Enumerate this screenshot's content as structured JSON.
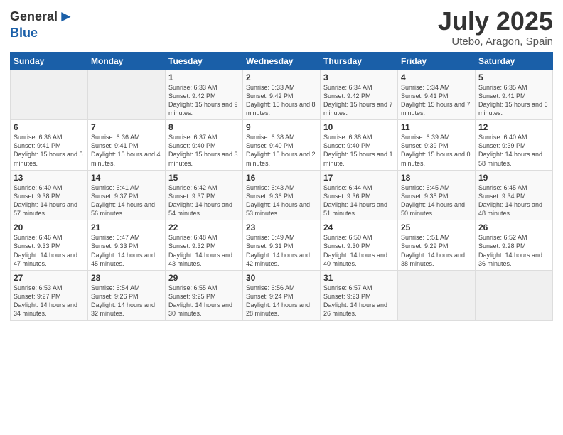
{
  "header": {
    "logo_general": "General",
    "logo_blue": "Blue",
    "month_year": "July 2025",
    "location": "Utebo, Aragon, Spain"
  },
  "weekdays": [
    "Sunday",
    "Monday",
    "Tuesday",
    "Wednesday",
    "Thursday",
    "Friday",
    "Saturday"
  ],
  "weeks": [
    [
      {
        "day": "",
        "info": ""
      },
      {
        "day": "",
        "info": ""
      },
      {
        "day": "1",
        "info": "Sunrise: 6:33 AM\nSunset: 9:42 PM\nDaylight: 15 hours\nand 9 minutes."
      },
      {
        "day": "2",
        "info": "Sunrise: 6:33 AM\nSunset: 9:42 PM\nDaylight: 15 hours\nand 8 minutes."
      },
      {
        "day": "3",
        "info": "Sunrise: 6:34 AM\nSunset: 9:42 PM\nDaylight: 15 hours\nand 7 minutes."
      },
      {
        "day": "4",
        "info": "Sunrise: 6:34 AM\nSunset: 9:41 PM\nDaylight: 15 hours\nand 7 minutes."
      },
      {
        "day": "5",
        "info": "Sunrise: 6:35 AM\nSunset: 9:41 PM\nDaylight: 15 hours\nand 6 minutes."
      }
    ],
    [
      {
        "day": "6",
        "info": "Sunrise: 6:36 AM\nSunset: 9:41 PM\nDaylight: 15 hours\nand 5 minutes."
      },
      {
        "day": "7",
        "info": "Sunrise: 6:36 AM\nSunset: 9:41 PM\nDaylight: 15 hours\nand 4 minutes."
      },
      {
        "day": "8",
        "info": "Sunrise: 6:37 AM\nSunset: 9:40 PM\nDaylight: 15 hours\nand 3 minutes."
      },
      {
        "day": "9",
        "info": "Sunrise: 6:38 AM\nSunset: 9:40 PM\nDaylight: 15 hours\nand 2 minutes."
      },
      {
        "day": "10",
        "info": "Sunrise: 6:38 AM\nSunset: 9:40 PM\nDaylight: 15 hours\nand 1 minute."
      },
      {
        "day": "11",
        "info": "Sunrise: 6:39 AM\nSunset: 9:39 PM\nDaylight: 15 hours\nand 0 minutes."
      },
      {
        "day": "12",
        "info": "Sunrise: 6:40 AM\nSunset: 9:39 PM\nDaylight: 14 hours\nand 58 minutes."
      }
    ],
    [
      {
        "day": "13",
        "info": "Sunrise: 6:40 AM\nSunset: 9:38 PM\nDaylight: 14 hours\nand 57 minutes."
      },
      {
        "day": "14",
        "info": "Sunrise: 6:41 AM\nSunset: 9:37 PM\nDaylight: 14 hours\nand 56 minutes."
      },
      {
        "day": "15",
        "info": "Sunrise: 6:42 AM\nSunset: 9:37 PM\nDaylight: 14 hours\nand 54 minutes."
      },
      {
        "day": "16",
        "info": "Sunrise: 6:43 AM\nSunset: 9:36 PM\nDaylight: 14 hours\nand 53 minutes."
      },
      {
        "day": "17",
        "info": "Sunrise: 6:44 AM\nSunset: 9:36 PM\nDaylight: 14 hours\nand 51 minutes."
      },
      {
        "day": "18",
        "info": "Sunrise: 6:45 AM\nSunset: 9:35 PM\nDaylight: 14 hours\nand 50 minutes."
      },
      {
        "day": "19",
        "info": "Sunrise: 6:45 AM\nSunset: 9:34 PM\nDaylight: 14 hours\nand 48 minutes."
      }
    ],
    [
      {
        "day": "20",
        "info": "Sunrise: 6:46 AM\nSunset: 9:33 PM\nDaylight: 14 hours\nand 47 minutes."
      },
      {
        "day": "21",
        "info": "Sunrise: 6:47 AM\nSunset: 9:33 PM\nDaylight: 14 hours\nand 45 minutes."
      },
      {
        "day": "22",
        "info": "Sunrise: 6:48 AM\nSunset: 9:32 PM\nDaylight: 14 hours\nand 43 minutes."
      },
      {
        "day": "23",
        "info": "Sunrise: 6:49 AM\nSunset: 9:31 PM\nDaylight: 14 hours\nand 42 minutes."
      },
      {
        "day": "24",
        "info": "Sunrise: 6:50 AM\nSunset: 9:30 PM\nDaylight: 14 hours\nand 40 minutes."
      },
      {
        "day": "25",
        "info": "Sunrise: 6:51 AM\nSunset: 9:29 PM\nDaylight: 14 hours\nand 38 minutes."
      },
      {
        "day": "26",
        "info": "Sunrise: 6:52 AM\nSunset: 9:28 PM\nDaylight: 14 hours\nand 36 minutes."
      }
    ],
    [
      {
        "day": "27",
        "info": "Sunrise: 6:53 AM\nSunset: 9:27 PM\nDaylight: 14 hours\nand 34 minutes."
      },
      {
        "day": "28",
        "info": "Sunrise: 6:54 AM\nSunset: 9:26 PM\nDaylight: 14 hours\nand 32 minutes."
      },
      {
        "day": "29",
        "info": "Sunrise: 6:55 AM\nSunset: 9:25 PM\nDaylight: 14 hours\nand 30 minutes."
      },
      {
        "day": "30",
        "info": "Sunrise: 6:56 AM\nSunset: 9:24 PM\nDaylight: 14 hours\nand 28 minutes."
      },
      {
        "day": "31",
        "info": "Sunrise: 6:57 AM\nSunset: 9:23 PM\nDaylight: 14 hours\nand 26 minutes."
      },
      {
        "day": "",
        "info": ""
      },
      {
        "day": "",
        "info": ""
      }
    ]
  ]
}
